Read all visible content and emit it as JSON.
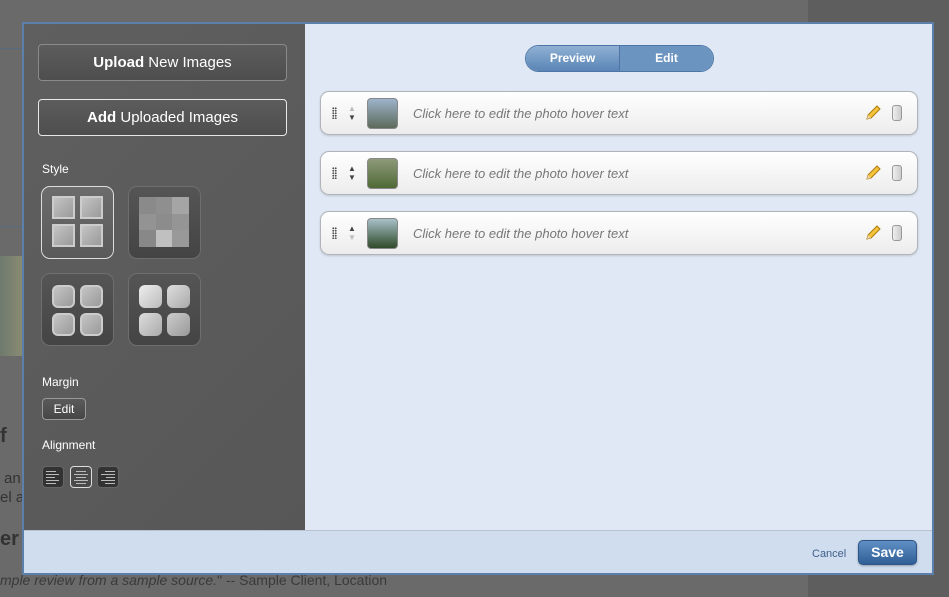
{
  "background": {
    "fragments": [
      "f",
      "an",
      "el a",
      "er l"
    ],
    "quote_italic": "mple review from a sample source.",
    "quote_rest": "\" -- Sample Client, Location"
  },
  "left_panel": {
    "upload_bold": "Upload",
    "upload_rest": " New Images",
    "add_bold": "Add",
    "add_rest": " Uploaded Images",
    "style_label": "Style",
    "styles": [
      {
        "name": "square-grid",
        "selected": true
      },
      {
        "name": "mosaic",
        "selected": false
      },
      {
        "name": "rounded-grid",
        "selected": false
      },
      {
        "name": "rounded-grid-light",
        "selected": false
      }
    ],
    "margin_label": "Margin",
    "margin_edit": "Edit",
    "alignment_label": "Alignment",
    "alignments": [
      {
        "name": "left",
        "selected": false
      },
      {
        "name": "center",
        "selected": true
      },
      {
        "name": "right",
        "selected": false
      }
    ]
  },
  "main": {
    "toggle": {
      "preview": "Preview",
      "edit": "Edit",
      "active": "Edit"
    },
    "photos": [
      {
        "hover_text": "Click here to edit the photo hover text",
        "up_enabled": false,
        "down_enabled": true,
        "thumb_colors": [
          "#9db3cc",
          "#5d6a5a"
        ]
      },
      {
        "hover_text": "Click here to edit the photo hover text",
        "up_enabled": true,
        "down_enabled": true,
        "thumb_colors": [
          "#8e9a7a",
          "#4f6a35"
        ]
      },
      {
        "hover_text": "Click here to edit the photo hover text",
        "up_enabled": true,
        "down_enabled": false,
        "thumb_colors": [
          "#a8c0c8",
          "#2f4a2a"
        ]
      }
    ]
  },
  "footer": {
    "cancel": "Cancel",
    "save": "Save"
  },
  "colors": {
    "accent": "#2f5f96",
    "panel": "#5b5b5b",
    "content_bg": "#dfe8f4"
  }
}
